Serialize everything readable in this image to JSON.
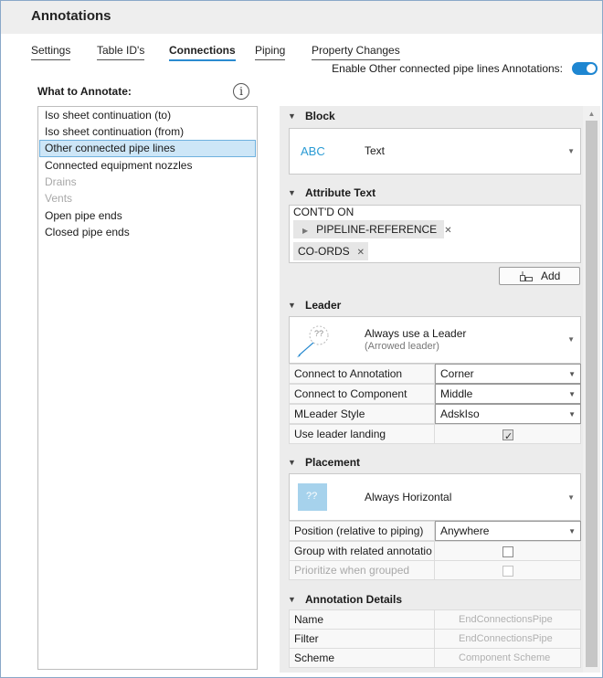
{
  "window": {
    "title": "Annotations"
  },
  "tabs": [
    {
      "label": "Settings",
      "active": false
    },
    {
      "label": "Table ID's",
      "active": false
    },
    {
      "label": "Connections",
      "active": true
    },
    {
      "label": "Piping",
      "active": false
    },
    {
      "label": "Property Changes",
      "active": false
    }
  ],
  "enable_toggle": {
    "label": "Enable Other connected pipe lines Annotations:",
    "on": true
  },
  "what_to_annotate": {
    "label": "What to Annotate:",
    "items": [
      {
        "label": "Iso sheet continuation (to)",
        "state": "normal"
      },
      {
        "label": "Iso sheet continuation (from)",
        "state": "normal"
      },
      {
        "label": "Other connected pipe lines",
        "state": "selected"
      },
      {
        "label": "Connected equipment nozzles",
        "state": "normal"
      },
      {
        "label": "Drains",
        "state": "disabled"
      },
      {
        "label": "Vents",
        "state": "disabled"
      },
      {
        "label": "Open pipe ends",
        "state": "normal"
      },
      {
        "label": "Closed pipe ends",
        "state": "normal"
      }
    ]
  },
  "sections": {
    "block": {
      "header": "Block",
      "preview_text": "ABC",
      "value": "Text"
    },
    "attribute_text": {
      "header": "Attribute Text",
      "line": "CONT'D ON",
      "chips": [
        "PIPELINE-REFERENCE",
        "CO-ORDS"
      ],
      "add_label": "Add"
    },
    "leader": {
      "header": "Leader",
      "preview_text": "??",
      "value": "Always use a Leader",
      "subvalue": "(Arrowed leader)",
      "rows": [
        {
          "key": "Connect to Annotation",
          "value": "Corner"
        },
        {
          "key": "Connect to Component",
          "value": "Middle"
        },
        {
          "key": "MLeader Style",
          "value": "AdskIso"
        },
        {
          "key": "Use leader landing",
          "checked": true
        }
      ]
    },
    "placement": {
      "header": "Placement",
      "preview_text": "??",
      "value": "Always Horizontal",
      "rows": [
        {
          "key": "Position (relative to piping)",
          "value": "Anywhere"
        },
        {
          "key": "Group with related annotatio",
          "checked": false
        },
        {
          "key": "Prioritize when grouped",
          "checked": false,
          "disabled": true
        }
      ]
    },
    "annotation_details": {
      "header": "Annotation Details",
      "rows": [
        {
          "key": "Name",
          "value": "EndConnectionsPipe"
        },
        {
          "key": "Filter",
          "value": "EndConnectionsPipe"
        },
        {
          "key": "Scheme",
          "value": "Component Scheme"
        }
      ]
    }
  },
  "colors": {
    "accent": "#2a8bd0",
    "toggle_on": "#1e86d1",
    "selection_bg": "#cde6f7",
    "abc_text": "#2a9bd4"
  }
}
